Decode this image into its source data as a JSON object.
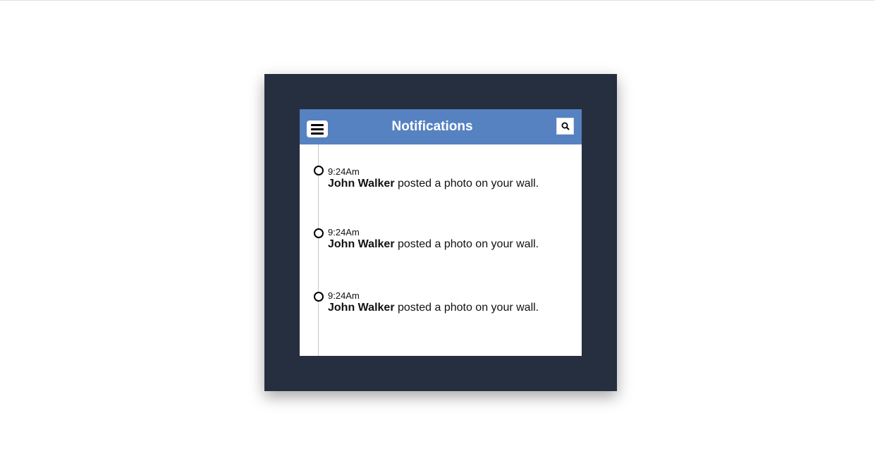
{
  "header": {
    "title": "Notifications",
    "menu_icon": "hamburger-menu-icon",
    "search_icon": "search-icon"
  },
  "colors": {
    "frame": "#262f3f",
    "header": "#5682c1",
    "card": "#ffffff"
  },
  "notifications": [
    {
      "time": "9:24Am",
      "name": "John Walker",
      "action": " posted a photo on your wall."
    },
    {
      "time": "9:24Am",
      "name": "John Walker",
      "action": " posted a photo on your wall."
    },
    {
      "time": "9:24Am",
      "name": "John Walker",
      "action": " posted a photo on your wall."
    }
  ]
}
